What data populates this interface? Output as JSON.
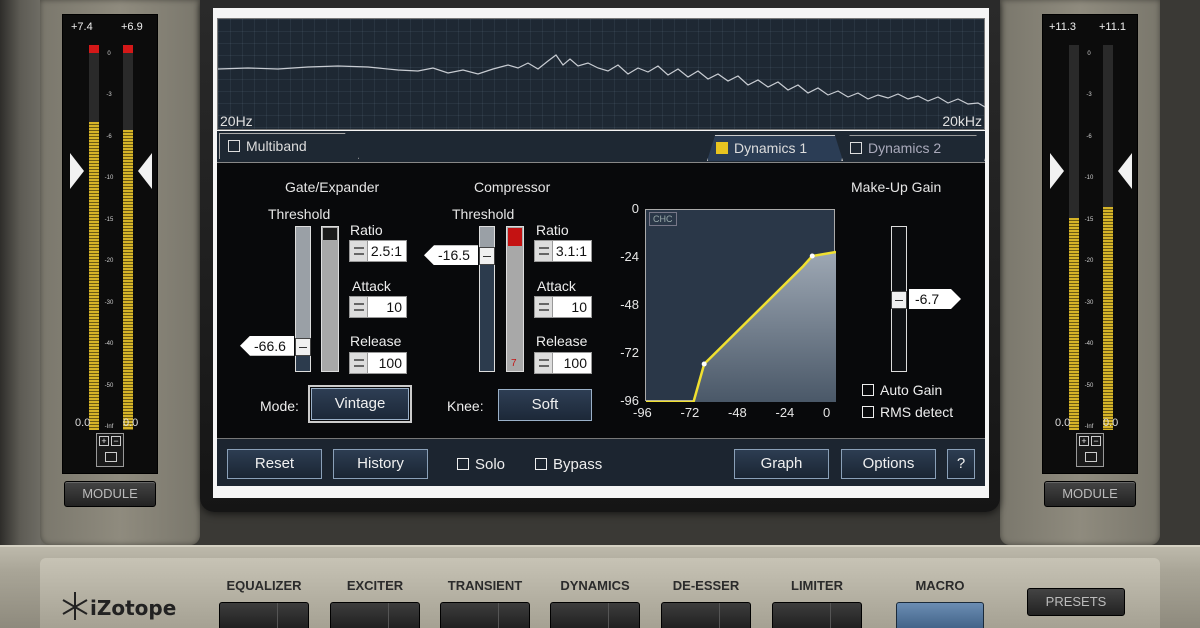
{
  "input_meter": {
    "left_peak": "+7.4",
    "right_peak": "+6.9",
    "left_zero": "0.0",
    "right_zero": "0.0",
    "left_level": 0.8,
    "right_level": 0.78,
    "scale": [
      "0",
      "-3",
      "-6",
      "-10",
      "-15",
      "-20",
      "-30",
      "-40",
      "-50",
      "-Inf"
    ]
  },
  "output_meter": {
    "left_peak": "+11.3",
    "right_peak": "+11.1",
    "left_zero": "0.0",
    "right_zero": "0.0",
    "left_level": 0.55,
    "right_level": 0.58,
    "scale": [
      "0",
      "-3",
      "-6",
      "-10",
      "-15",
      "-20",
      "-30",
      "-40",
      "-50",
      "-Inf"
    ]
  },
  "link_icons": {
    "plus": "+",
    "minus": "−"
  },
  "module_label": "MODULE",
  "spectrum": {
    "low_label": "20Hz",
    "high_label": "20kHz"
  },
  "tabs": {
    "multiband": "Multiband",
    "dynamics1": "Dynamics 1",
    "dynamics2": "Dynamics 2"
  },
  "gate": {
    "title": "Gate/Expander",
    "threshold_label": "Threshold",
    "threshold_value": "-66.6",
    "threshold_level": 0.18,
    "ratio_label": "Ratio",
    "ratio_value": "2.5:1",
    "attack_label": "Attack",
    "attack_value": "10",
    "release_label": "Release",
    "release_value": "100",
    "mode_label": "Mode:",
    "mode_value": "Vintage"
  },
  "compressor": {
    "title": "Compressor",
    "threshold_label": "Threshold",
    "threshold_value": "-16.5",
    "threshold_level": 0.8,
    "ratio_label": "Ratio",
    "ratio_value": "3.1:1",
    "attack_label": "Attack",
    "attack_value": "10",
    "release_label": "Release",
    "release_value": "100",
    "knee_label": "Knee:",
    "knee_value": "Soft",
    "gr_value": "7"
  },
  "graph": {
    "y_ticks": [
      "0",
      "-24",
      "-48",
      "-72",
      "-96"
    ],
    "x_ticks": [
      "-96",
      "-72",
      "-48",
      "-24",
      "0"
    ],
    "corner_label": "CHC"
  },
  "chart_data": {
    "type": "line",
    "title": "",
    "xlabel": "",
    "ylabel": "",
    "xlim": [
      -96,
      0
    ],
    "ylim": [
      -96,
      0
    ],
    "series": [
      {
        "x": [
          -96,
          -72,
          -66.6,
          -16.5,
          -12,
          0
        ],
        "y": [
          -96,
          -96,
          -77,
          -28,
          -23,
          -21
        ]
      }
    ]
  },
  "makeup": {
    "title": "Make-Up Gain",
    "value": "-6.7",
    "level": 0.5,
    "auto_gain": "Auto Gain",
    "rms_detect": "RMS detect"
  },
  "footer": {
    "reset": "Reset",
    "history": "History",
    "solo": "Solo",
    "bypass": "Bypass",
    "graph": "Graph",
    "options": "Options",
    "help": "?"
  },
  "brand": "iZotope",
  "modules": [
    "EQUALIZER",
    "EXCITER",
    "TRANSIENT",
    "DYNAMICS",
    "DE-ESSER",
    "LIMITER"
  ],
  "macro_label": "MACRO",
  "presets_label": "PRESETS",
  "colors": {
    "accent_yellow": "#f0e030",
    "plot_bg": "#2a3748",
    "panel_bg": "#08090b"
  }
}
